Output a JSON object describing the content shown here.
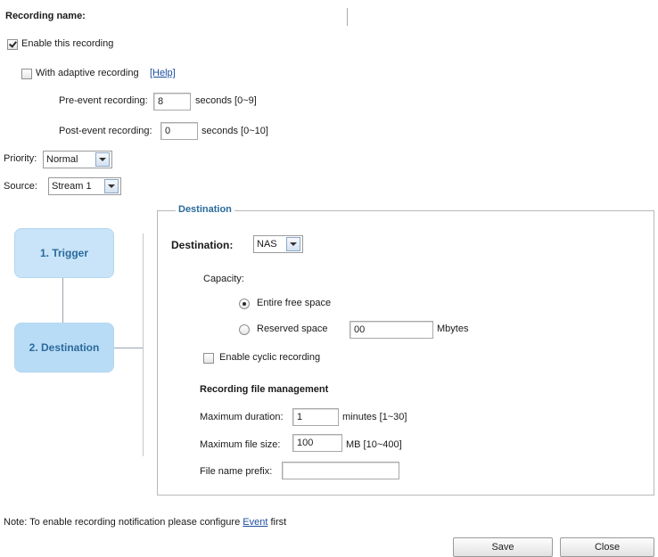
{
  "recording_name": {
    "label": "Recording name:",
    "value": ""
  },
  "enable_recording": {
    "label": "Enable this recording",
    "checked": true
  },
  "adaptive": {
    "label": "With adaptive recording",
    "help_link": "[Help]",
    "checked": false
  },
  "pre_event": {
    "label": "Pre-event recording:",
    "value": "8",
    "unit": "seconds [0~9]"
  },
  "post_event": {
    "label": "Post-event recording:",
    "value": "0",
    "unit": "seconds [0~10]"
  },
  "priority": {
    "label": "Priority:",
    "value": "Normal"
  },
  "source": {
    "label": "Source:",
    "value": "Stream 1"
  },
  "steps": {
    "trigger": "1. Trigger",
    "destination": "2. Destination"
  },
  "destination_panel": {
    "legend": "Destination",
    "dest_label": "Destination:",
    "dest_value": "NAS",
    "capacity_label": "Capacity:",
    "entire_free_space": "Entire free space",
    "reserved_space_label": "Reserved space",
    "reserved_space_value": "00",
    "reserved_space_unit": "Mbytes",
    "cyclic_label": "Enable cyclic recording",
    "file_mgmt_title": "Recording file management",
    "max_duration_label": "Maximum duration:",
    "max_duration_value": "1",
    "max_duration_unit": "minutes [1~30]",
    "max_file_size_label": "Maximum file size:",
    "max_file_size_value": "100",
    "max_file_size_unit": "MB [10~400]",
    "file_prefix_label": "File name prefix:",
    "file_prefix_value": ""
  },
  "note": {
    "text": "Note: To enable recording notification please configure ",
    "link": "Event",
    "suffix": " first"
  },
  "buttons": {
    "save": "Save",
    "close": "Close"
  }
}
